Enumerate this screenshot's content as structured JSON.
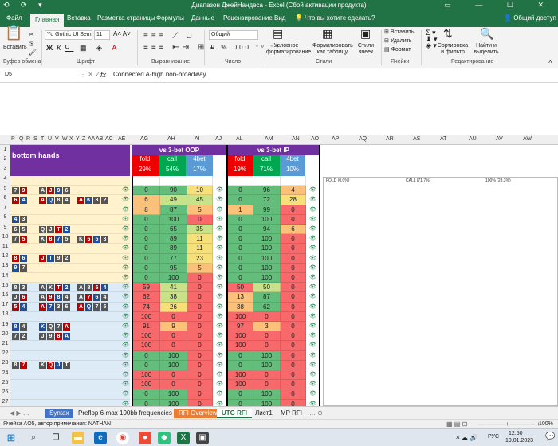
{
  "window": {
    "title": "Диапазон ДжейНандеса - Excel (Сбой активации продукта)",
    "qat": "⟲ ⟳ ▾",
    "controls": "▭ — ☐ ✕"
  },
  "ribbon_tabs": [
    "Файл",
    "Главная",
    "Вставка",
    "Разметка страницы",
    "Формулы",
    "Данные",
    "Рецензирование",
    "Вид"
  ],
  "tell_me": "Что вы хотите сделать?",
  "share": "Общий доступ",
  "ribbon": {
    "paste": "Вставить",
    "clipboard": "Буфер обмена",
    "font_name": "Yu Gothic UI Sem",
    "font_size": "11",
    "font": "Шрифт",
    "alignment": "Выравнивание",
    "number_format": "Общий",
    "number": "Число",
    "cond_format": "Условное форматирование",
    "format_table": "Форматировать как таблицу",
    "cell_styles": "Стили ячеек",
    "styles": "Стили",
    "insert": "Вставить",
    "delete": "Удалить",
    "format": "Формат",
    "cells": "Ячейки",
    "sort_filter": "Сортировка и фильтр",
    "find_select": "Найти и выделить",
    "editing": "Редактирование"
  },
  "formula_bar": {
    "name_box": "D5",
    "fx": "fx",
    "content": "Connected A-high non-broadway"
  },
  "columns": [
    "P",
    "Q",
    "R",
    "S",
    "T",
    "U",
    "V",
    "W",
    "X",
    "Y",
    "Z",
    "AA",
    "AB",
    "AC",
    "AE",
    "AG",
    "AH",
    "AI",
    "AJ",
    "AL",
    "AM",
    "AN",
    "AO",
    "AP",
    "AQ",
    "AR",
    "AS",
    "AT",
    "AU",
    "AV",
    "AW"
  ],
  "rows": [
    "1",
    "2",
    "3",
    "4",
    "5",
    "6",
    "7",
    "8",
    "9",
    "10",
    "11",
    "12",
    "13",
    "14",
    "15",
    "16",
    "17",
    "18",
    "19",
    "20",
    "21",
    "22",
    "23",
    "24",
    "25",
    "26",
    "27"
  ],
  "sheet": {
    "section_label": "bottom hands",
    "oop_title": "vs 3-bet OOP",
    "ip_title": "vs 3-bet IP",
    "labels": {
      "fold": "fold",
      "call": "call",
      "bet4": "4bet"
    },
    "oop_pct": {
      "fold": "29%",
      "call": "54%",
      "bet4": "17%"
    },
    "ip_pct": {
      "fold": "19%",
      "call": "71%",
      "bet4": "10%"
    },
    "fold_label": "FOLD (0.0%)",
    "call_label": "CALL (71.7%)",
    "ip_label": "100% (28.3%)",
    "table": [
      {
        "row": "4",
        "oop": [
          "",
          "",
          "",
          ""
        ],
        "ip": [
          "",
          "",
          "",
          ""
        ]
      },
      {
        "row": "5",
        "oop": [
          "0",
          "90",
          "10"
        ],
        "ip": [
          "0",
          "96",
          "4"
        ]
      },
      {
        "row": "6",
        "oop": [
          "6",
          "49",
          "45"
        ],
        "ip": [
          "0",
          "72",
          "28"
        ]
      },
      {
        "row": "7",
        "oop": [
          "8",
          "87",
          "5"
        ],
        "ip": [
          "1",
          "99",
          "0"
        ]
      },
      {
        "row": "8",
        "oop": [
          "0",
          "100",
          "0"
        ],
        "ip": [
          "0",
          "100",
          "0"
        ]
      },
      {
        "row": "9",
        "oop": [
          "0",
          "65",
          "35"
        ],
        "ip": [
          "0",
          "94",
          "6"
        ]
      },
      {
        "row": "10",
        "oop": [
          "0",
          "89",
          "11"
        ],
        "ip": [
          "0",
          "100",
          "0"
        ]
      },
      {
        "row": "11",
        "oop": [
          "0",
          "89",
          "11"
        ],
        "ip": [
          "0",
          "100",
          "0"
        ]
      },
      {
        "row": "12",
        "oop": [
          "0",
          "77",
          "23"
        ],
        "ip": [
          "0",
          "100",
          "0"
        ]
      },
      {
        "row": "13",
        "oop": [
          "0",
          "95",
          "5"
        ],
        "ip": [
          "0",
          "100",
          "0"
        ]
      },
      {
        "row": "14",
        "oop": [
          "0",
          "100",
          "0"
        ],
        "ip": [
          "0",
          "100",
          "0"
        ]
      },
      {
        "row": "15",
        "oop": [
          "59",
          "41",
          "0"
        ],
        "ip": [
          "50",
          "50",
          "0"
        ]
      },
      {
        "row": "16",
        "oop": [
          "62",
          "38",
          "0"
        ],
        "ip": [
          "13",
          "87",
          "0"
        ]
      },
      {
        "row": "17",
        "oop": [
          "74",
          "26",
          "0"
        ],
        "ip": [
          "38",
          "62",
          "0"
        ]
      },
      {
        "row": "18",
        "oop": [
          "100",
          "0",
          "0"
        ],
        "ip": [
          "100",
          "0",
          "0"
        ]
      },
      {
        "row": "19",
        "oop": [
          "91",
          "9",
          "0"
        ],
        "ip": [
          "97",
          "3",
          "0"
        ]
      },
      {
        "row": "20",
        "oop": [
          "100",
          "0",
          "0"
        ],
        "ip": [
          "100",
          "0",
          "0"
        ]
      },
      {
        "row": "21",
        "oop": [
          "100",
          "0",
          "0"
        ],
        "ip": [
          "100",
          "0",
          "0"
        ]
      },
      {
        "row": "22",
        "oop": [
          "0",
          "100",
          "0"
        ],
        "ip": [
          "0",
          "100",
          "0"
        ]
      },
      {
        "row": "23",
        "oop": [
          "0",
          "100",
          "0"
        ],
        "ip": [
          "0",
          "100",
          "0"
        ]
      },
      {
        "row": "24",
        "oop": [
          "100",
          "0",
          "0"
        ],
        "ip": [
          "100",
          "0",
          "0"
        ]
      },
      {
        "row": "25",
        "oop": [
          "100",
          "0",
          "0"
        ],
        "ip": [
          "100",
          "0",
          "0"
        ]
      },
      {
        "row": "26",
        "oop": [
          "0",
          "100",
          "0"
        ],
        "ip": [
          "0",
          "100",
          "0"
        ]
      },
      {
        "row": "27",
        "oop": [
          "0",
          "100",
          "0"
        ],
        "ip": [
          "0",
          "100",
          "0"
        ]
      }
    ],
    "hands": [
      {
        "row": "5",
        "a": [
          "7",
          "9"
        ],
        "b": [
          "A",
          "J",
          "9",
          "6"
        ],
        "c": []
      },
      {
        "row": "6",
        "a": [
          "6",
          "4"
        ],
        "b": [
          "A",
          "Q",
          "8",
          "4"
        ],
        "c": [
          "A",
          "K",
          "3",
          "2"
        ]
      },
      {
        "row": "8",
        "a": [
          "4",
          "3"
        ],
        "b": [],
        "c": []
      },
      {
        "row": "9",
        "a": [
          "6",
          "5"
        ],
        "b": [
          "Q",
          "J",
          "T",
          "2"
        ],
        "c": []
      },
      {
        "row": "10",
        "a": [
          "7",
          "5"
        ],
        "b": [
          "K",
          "8",
          "7",
          "5"
        ],
        "c": [
          "K",
          "6",
          "5",
          "3"
        ]
      },
      {
        "row": "12",
        "a": [
          "8",
          "6"
        ],
        "b": [
          "J",
          "T",
          "9",
          "2"
        ],
        "c": []
      },
      {
        "row": "13",
        "a": [
          "9",
          "7"
        ],
        "b": [],
        "c": []
      },
      {
        "row": "15",
        "a": [
          "8",
          "3"
        ],
        "b": [
          "A",
          "K",
          "T",
          "2"
        ],
        "c": [
          "A",
          "8",
          "5",
          "4"
        ]
      },
      {
        "row": "16",
        "a": [
          "J",
          "6"
        ],
        "b": [
          "A",
          "9",
          "8",
          "4"
        ],
        "c": [
          "A",
          "7",
          "6",
          "4"
        ]
      },
      {
        "row": "17",
        "a": [
          "5",
          "4"
        ],
        "b": [
          "A",
          "7",
          "3",
          "6"
        ],
        "c": [
          "A",
          "Q",
          "7",
          "5"
        ]
      },
      {
        "row": "19",
        "a": [
          "8",
          "4"
        ],
        "b": [
          "K",
          "Q",
          "7",
          "A"
        ],
        "c": []
      },
      {
        "row": "20",
        "a": [
          "7",
          "2"
        ],
        "b": [
          "J",
          "9",
          "8",
          "A"
        ],
        "c": []
      },
      {
        "row": "23",
        "a": [
          "8",
          "7"
        ],
        "b": [
          "K",
          "Q",
          "J",
          "T"
        ],
        "c": []
      }
    ]
  },
  "sheet_tabs": [
    "Syntax",
    "Preflop 6-max 100bb frequencies",
    "RFI Overview",
    "UTG RFI",
    "Лист1",
    "MP RFI"
  ],
  "active_sheet": "UTG RFI",
  "status_text": "Ячейка AO5, автор примечания: NATHAN",
  "zoom": "100%",
  "time": "12:50",
  "date": "19.01.2023",
  "lang": "РУС"
}
